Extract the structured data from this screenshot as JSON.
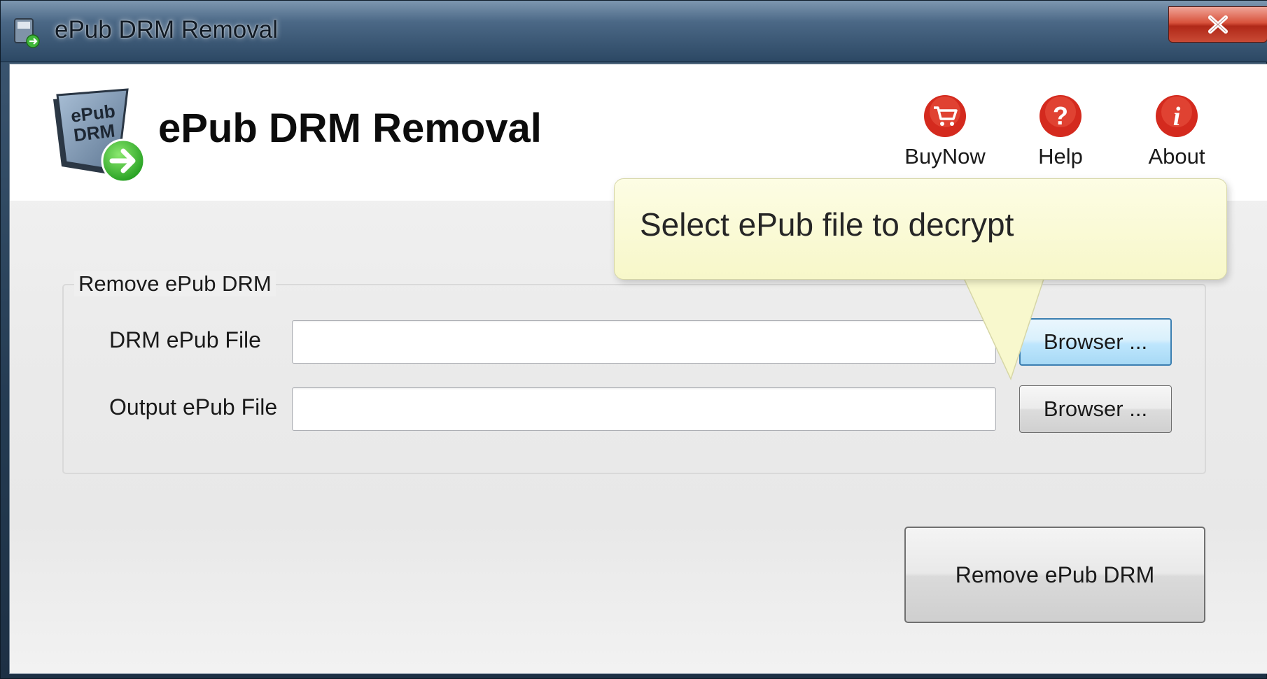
{
  "window": {
    "title": "ePub DRM Removal",
    "close_icon": "close-icon"
  },
  "header": {
    "app_title": "ePub DRM Removal",
    "logo_text_line1": "ePub",
    "logo_text_line2": "DRM",
    "actions": [
      {
        "label": "BuyNow",
        "icon": "cart-icon"
      },
      {
        "label": "Help",
        "icon": "help-icon"
      },
      {
        "label": "About",
        "icon": "info-icon"
      }
    ]
  },
  "tooltip": {
    "text": "Select ePub file to decrypt"
  },
  "group": {
    "label": "Remove ePub DRM",
    "drm_file": {
      "label": "DRM ePub File",
      "value": "",
      "button": "Browser ..."
    },
    "output_file": {
      "label": "Output ePub File",
      "value": "",
      "button": "Browser ..."
    }
  },
  "remove_button": "Remove ePub DRM",
  "colors": {
    "action_red": "#d42a1e",
    "tooltip_bg": "#f9f9d2",
    "hot_button_border": "#3c7fb1"
  }
}
